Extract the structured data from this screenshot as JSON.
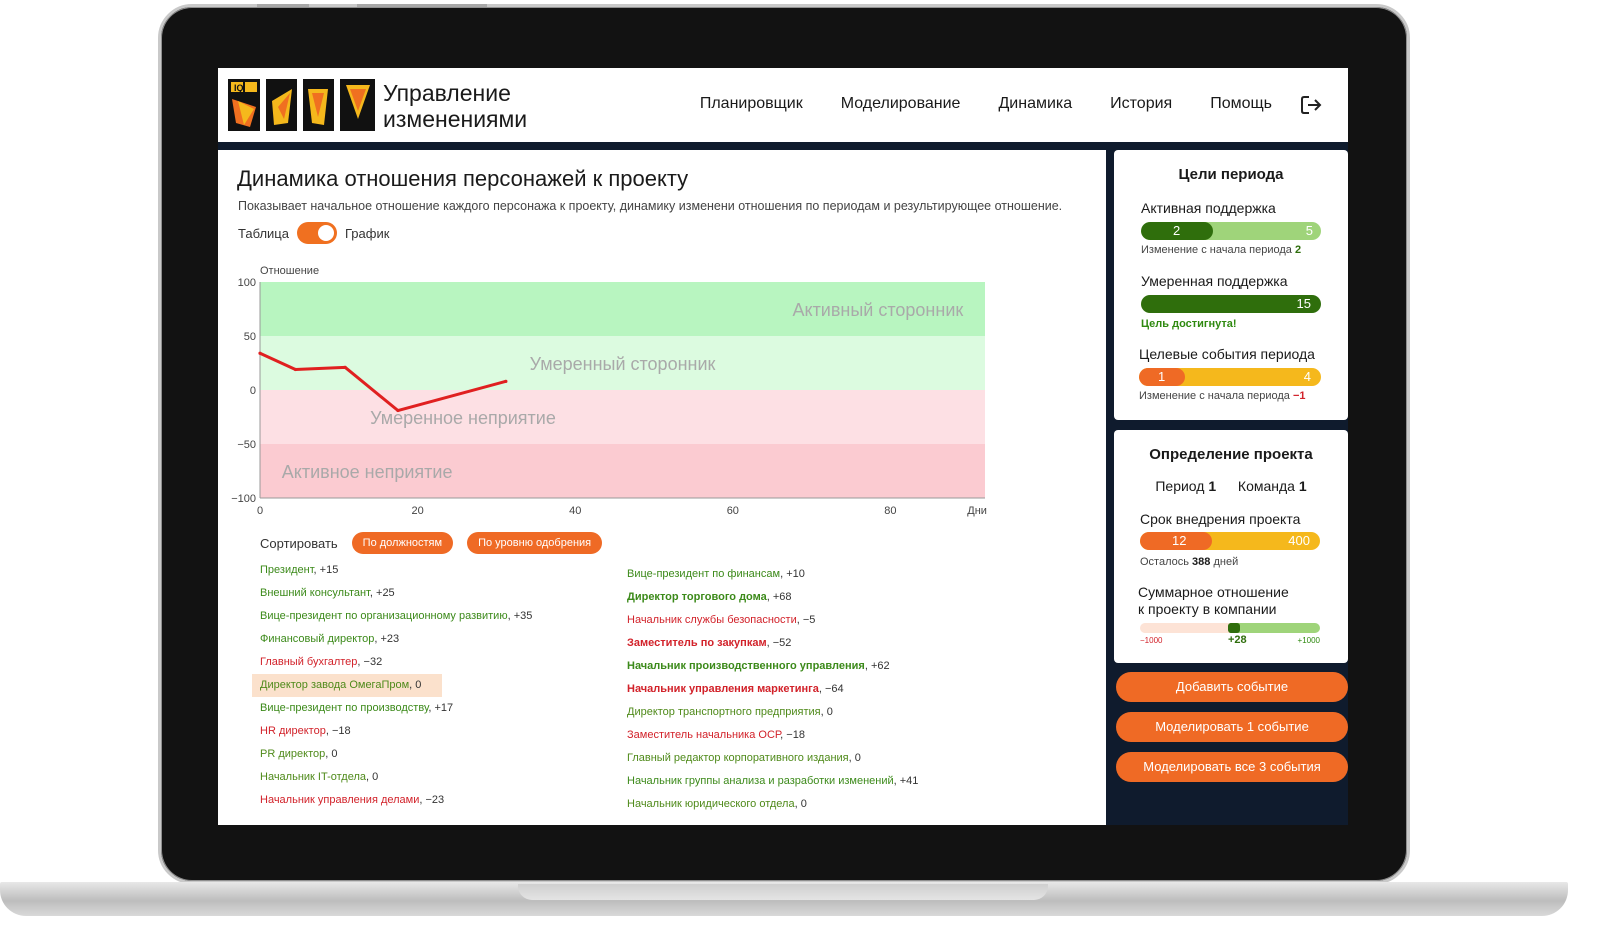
{
  "app": {
    "logo_text": "IQ",
    "brand_line1": "Управление",
    "brand_line2": "изменениями"
  },
  "nav": {
    "items": [
      "Планировщик",
      "Моделирование",
      "Динамика",
      "История",
      "Помощь"
    ],
    "logout_icon": "logout-icon"
  },
  "page": {
    "title": "Динамика отношения персонажей к проекту",
    "description": "Показывает начальное отношение каждого персонажа к проекту, динамику изменени отношения по периодам и результирующее отношение.",
    "toggle_left": "Таблица",
    "toggle_right": "График",
    "toggle_on": true
  },
  "chart_data": {
    "type": "line",
    "ylabel": "Отношение",
    "xlabel": "Дни",
    "ylim": [
      -100,
      100
    ],
    "xlim": [
      0,
      92
    ],
    "yticks": [
      "100",
      "50",
      "0",
      "−50",
      "−100"
    ],
    "xticks": [
      "0",
      "20",
      "40",
      "60",
      "80",
      "Дни"
    ],
    "zones": [
      {
        "label": "Активный сторонник",
        "from": 50,
        "to": 100,
        "color": "#b8f5c0"
      },
      {
        "label": "Умеренный сторонник",
        "from": 0,
        "to": 50,
        "color": "#dcfbe0"
      },
      {
        "label": "Умеренное неприятие",
        "from": -50,
        "to": 0,
        "color": "#fde0e4"
      },
      {
        "label": "Активное неприятие",
        "from": -100,
        "to": -50,
        "color": "#fbcbd1"
      }
    ],
    "series": [
      {
        "color": "#e02020",
        "x": [
          0,
          4.5,
          10.8,
          17.5,
          31.2
        ],
        "y": [
          34,
          19,
          21,
          -19,
          8
        ]
      }
    ]
  },
  "sort": {
    "label": "Сортировать",
    "buttons": [
      "По должностям",
      "По уровню одобрения"
    ]
  },
  "people_left": [
    {
      "name": "Президент",
      "value": "+15",
      "tone": "pos",
      "bold": false
    },
    {
      "name": "Внешний консультант",
      "value": "+25",
      "tone": "pos",
      "bold": false
    },
    {
      "name": "Вице-президент по организационному развитию",
      "value": "+35",
      "tone": "pos",
      "bold": false
    },
    {
      "name": "Финансовый директор",
      "value": "+23",
      "tone": "pos",
      "bold": false
    },
    {
      "name": "Главный бухгалтер",
      "value": "−32",
      "tone": "neg",
      "bold": false
    },
    {
      "name": "Директор завода ОмегаПром",
      "value": "0",
      "tone": "neu",
      "bold": false,
      "highlight": true
    },
    {
      "name": "Вице-президент по производству",
      "value": "+17",
      "tone": "pos",
      "bold": false
    },
    {
      "name": "HR директор",
      "value": "−18",
      "tone": "neg",
      "bold": false
    },
    {
      "name": "PR директор",
      "value": "0",
      "tone": "neu",
      "bold": false
    },
    {
      "name": "Начальник IT-отдела",
      "value": "0",
      "tone": "neu",
      "bold": false
    },
    {
      "name": "Начальник управления делами",
      "value": "−23",
      "tone": "neg",
      "bold": false
    }
  ],
  "people_right": [
    {
      "name": "Вице-президент по финансам",
      "value": "+10",
      "tone": "pos",
      "bold": false
    },
    {
      "name": "Директор торгового дома",
      "value": "+68",
      "tone": "pos",
      "bold": true
    },
    {
      "name": "Начальник службы безопасности",
      "value": "−5",
      "tone": "neg",
      "bold": false
    },
    {
      "name": "Заместитель по закупкам",
      "value": "−52",
      "tone": "neg",
      "bold": true
    },
    {
      "name": "Начальник производственного управления",
      "value": "+62",
      "tone": "pos",
      "bold": true
    },
    {
      "name": "Начальник управления маркетинга",
      "value": "−64",
      "tone": "neg",
      "bold": true
    },
    {
      "name": "Директор транспортного предприятия",
      "value": "0",
      "tone": "neu",
      "bold": false
    },
    {
      "name": "Заместитель начальника ОСР",
      "value": "−18",
      "tone": "neg",
      "bold": false
    },
    {
      "name": "Главный редактор корпоративного издания",
      "value": "0",
      "tone": "neu",
      "bold": false
    },
    {
      "name": "Начальник группы анализа и разработки изменений",
      "value": "+41",
      "tone": "pos",
      "bold": false
    },
    {
      "name": "Начальник юридического отдела",
      "value": "0",
      "tone": "neu",
      "bold": false
    }
  ],
  "goals": {
    "title": "Цели периода",
    "active_label": "Активная поддержка",
    "active_current": "2",
    "active_target": "5",
    "active_fraction": 0.4,
    "active_note_prefix": "Изменение с начала периода",
    "active_note_value": "2",
    "moderate_label": "Умеренная поддержка",
    "moderate_target": "15",
    "moderate_note": "Цель достигнута!",
    "events_label": "Целевые события периода",
    "events_current": "1",
    "events_target": "4",
    "events_fraction": 0.25,
    "events_note_prefix": "Изменение с начала периода",
    "events_note_value": "−1"
  },
  "project": {
    "title": "Определение проекта",
    "period_label": "Период",
    "period_value": "1",
    "team_label": "Команда",
    "team_value": "1",
    "deadline_label": "Срок внедрения проекта",
    "deadline_current": "12",
    "deadline_total": "400",
    "deadline_fraction": 0.4,
    "remaining_prefix": "Осталось",
    "remaining_value": "388",
    "remaining_suffix": "дней",
    "attitude_label_1": "Суммарное отношение",
    "attitude_label_2": "к проекту в компании",
    "attitude_min": "−1000",
    "attitude_max": "+1000",
    "attitude_value": "+28"
  },
  "actions": {
    "add_event": "Добавить событие",
    "model_one": "Моделировать 1 событие",
    "model_all": "Моделировать все 3 события"
  },
  "colors": {
    "accent": "#ef6a25",
    "dark_green": "#2f6e0c",
    "light_green": "#9fd47a",
    "yellow": "#f5b81c",
    "screen_bg": "#0f1b2d"
  }
}
